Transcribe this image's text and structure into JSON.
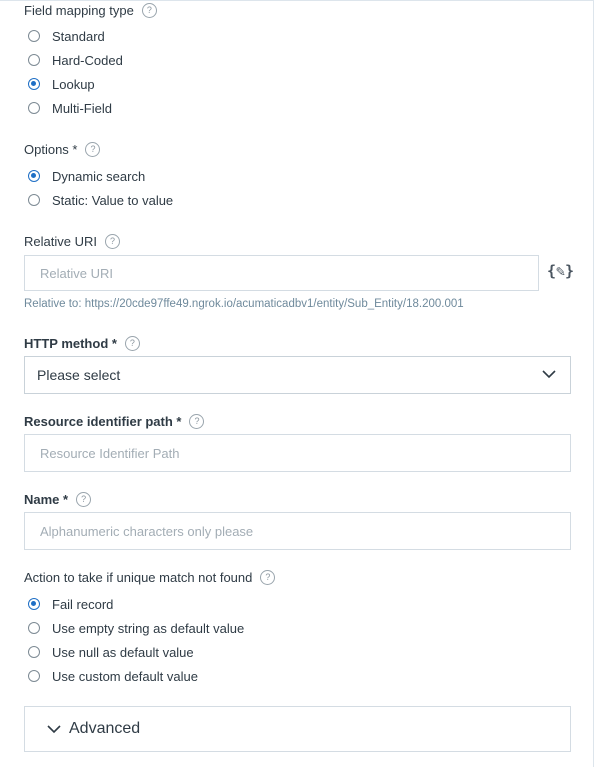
{
  "field_mapping_type": {
    "label": "Field mapping type",
    "help": "?",
    "options": [
      "Standard",
      "Hard-Coded",
      "Lookup",
      "Multi-Field"
    ],
    "selected": "Lookup"
  },
  "options": {
    "label": "Options *",
    "help": "?",
    "choices": [
      "Dynamic search",
      "Static: Value to value"
    ],
    "selected": "Dynamic search"
  },
  "relative_uri": {
    "label": "Relative URI",
    "help": "?",
    "placeholder": "Relative URI",
    "variable_icon": "{✎}",
    "hint": "Relative to: https://20cde97ffe49.ngrok.io/acumaticadbv1/entity/Sub_Entity/18.200.001"
  },
  "http_method": {
    "label": "HTTP method *",
    "help": "?",
    "value": "Please select"
  },
  "resource_identifier_path": {
    "label": "Resource identifier path *",
    "help": "?",
    "placeholder": "Resource Identifier Path"
  },
  "name": {
    "label": "Name *",
    "help": "?",
    "placeholder": "Alphanumeric characters only please"
  },
  "unique_match": {
    "label": "Action to take if unique match not found",
    "help": "?",
    "options": [
      "Fail record",
      "Use empty string as default value",
      "Use null as default value",
      "Use custom default value"
    ],
    "selected": "Fail record"
  },
  "advanced": {
    "label": "Advanced"
  },
  "colors": {
    "accent": "#1f6fc5",
    "text": "#2f3b45",
    "hint": "#6f8a9c",
    "border": "#d4dce3"
  }
}
